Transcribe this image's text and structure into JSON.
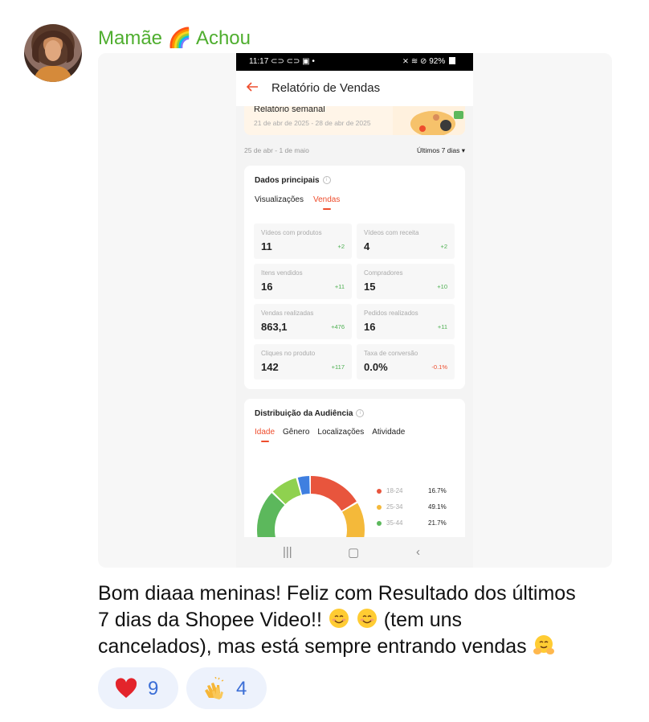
{
  "sender": {
    "name": "Mamãe",
    "emoji": "🌈",
    "name_suffix": "Achou"
  },
  "phone": {
    "status": {
      "time": "11:17",
      "left_icons": "⊂⊃ ⊂⊃ ▣ •",
      "right_icons": "⨯ ≋ ⊘",
      "battery": "92%"
    },
    "app_title": "Relatório de Vendas",
    "weekly": {
      "title": "Relatório semanal",
      "range": "21 de abr de 2025 - 28 de abr de 2025"
    },
    "date_range": "25 de abr - 1 de maio",
    "period_select": "Últimos 7 dias ▾",
    "main_card": {
      "title": "Dados principais",
      "tabs": [
        "Visualizações",
        "Vendas"
      ],
      "active_tab": 1,
      "metrics": [
        {
          "label": "Vídeos com produtos",
          "value": "11",
          "delta": "+2"
        },
        {
          "label": "Vídeos com receita",
          "value": "4",
          "delta": "+2"
        },
        {
          "label": "Itens vendidos",
          "value": "16",
          "delta": "+11"
        },
        {
          "label": "Compradores",
          "value": "15",
          "delta": "+10"
        },
        {
          "label": "Vendas realizadas",
          "value": "863,1",
          "delta": "+476"
        },
        {
          "label": "Pedidos realizados",
          "value": "16",
          "delta": "+11"
        },
        {
          "label": "Cliques no produto",
          "value": "142",
          "delta": "+117"
        },
        {
          "label": "Taxa de conversão",
          "value": "0.0%",
          "delta": "-0.1%"
        }
      ]
    },
    "audience_card": {
      "title": "Distribuição da Audiência",
      "tabs": [
        "Idade",
        "Gênero",
        "Localizações",
        "Atividade"
      ],
      "active_tab": 0,
      "legend": [
        {
          "label": "18-24",
          "value": "16.7%",
          "color": "#e8553d"
        },
        {
          "label": "25-34",
          "value": "49.1%",
          "color": "#f4b93a"
        },
        {
          "label": "35-44",
          "value": "21.7%",
          "color": "#5cb85c"
        }
      ],
      "donut_segments": [
        {
          "percent": 16.7,
          "color": "#e8553d"
        },
        {
          "percent": 49.1,
          "color": "#f4b93a"
        },
        {
          "percent": 21.7,
          "color": "#5cb85c"
        },
        {
          "percent": 8.5,
          "color": "#8fd14f"
        },
        {
          "percent": 4.0,
          "color": "#3f7fe0"
        }
      ]
    },
    "nav": {
      "recent": "|||",
      "home": "▢",
      "back": "‹"
    }
  },
  "message": {
    "line1": "Bom diaaa meninas! Feliz com Resultado dos últimos",
    "line2_start": "7 dias da Shopee Video!!",
    "line2_end": "(tem uns",
    "line3": "cancelados), mas está sempre entrando vendas"
  },
  "reactions": [
    {
      "emoji": "heart",
      "count": "9"
    },
    {
      "emoji": "clap",
      "count": "4"
    }
  ]
}
